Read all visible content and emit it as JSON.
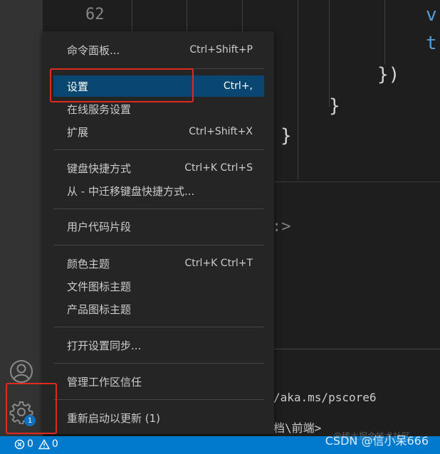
{
  "editor": {
    "line_number": "62",
    "code_lines": [
      {
        "text": "v",
        "kind": "kw"
      },
      {
        "text": "t",
        "kind": "kw"
      },
      {
        "text": "})",
        "kind": "plain"
      },
      {
        "text": "}",
        "kind": "plain"
      },
      {
        "text": "}",
        "kind": "plain"
      },
      {
        "text": ":>",
        "kind": "plain"
      }
    ]
  },
  "terminal": {
    "line1": "/aka.ms/pscore6",
    "line2": "档\\前端>"
  },
  "menu": {
    "items": [
      {
        "label": "命令面板...",
        "shortcut": "Ctrl+Shift+P"
      },
      {
        "label": "设置",
        "shortcut": "Ctrl+,"
      },
      {
        "label": "在线服务设置",
        "shortcut": ""
      },
      {
        "label": "扩展",
        "shortcut": "Ctrl+Shift+X"
      },
      {
        "label": "键盘快捷方式",
        "shortcut": "Ctrl+K Ctrl+S"
      },
      {
        "label": "从 - 中迁移键盘快捷方式...",
        "shortcut": ""
      },
      {
        "label": "用户代码片段",
        "shortcut": ""
      },
      {
        "label": "颜色主题",
        "shortcut": "Ctrl+K Ctrl+T"
      },
      {
        "label": "文件图标主题",
        "shortcut": ""
      },
      {
        "label": "产品图标主题",
        "shortcut": ""
      },
      {
        "label": "打开设置同步...",
        "shortcut": ""
      },
      {
        "label": "管理工作区信任",
        "shortcut": ""
      },
      {
        "label": "重新启动以更新 (1)",
        "shortcut": ""
      }
    ]
  },
  "activity_bar": {
    "accounts_icon": "account-icon",
    "manage_icon": "gear-icon",
    "badge_count": "1"
  },
  "status_bar": {
    "errors": "0",
    "warnings": "0",
    "watermark": "CSDN @信小呆666",
    "faint_watermark": "@稀土掘金技术社区"
  },
  "colors": {
    "accent": "#007acc",
    "menu_active": "#094771",
    "highlight": "#e0291f"
  }
}
